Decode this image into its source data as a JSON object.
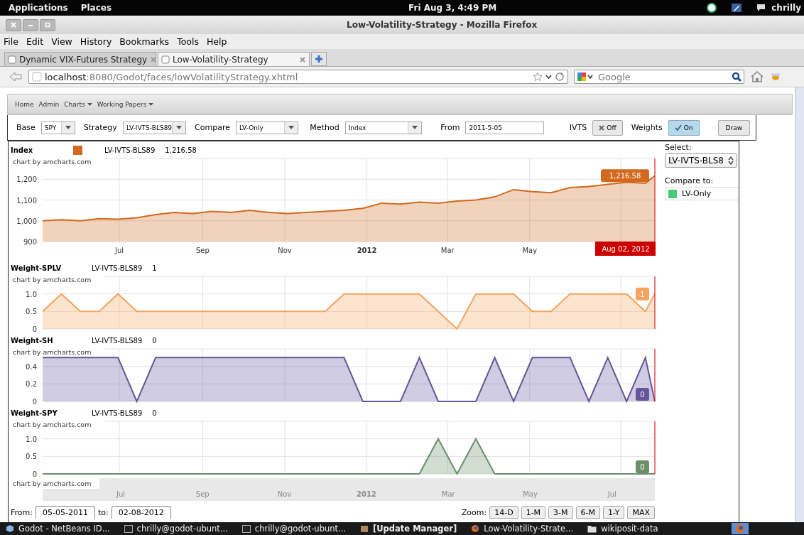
{
  "top_panel": {
    "menus": [
      "Applications",
      "Places"
    ],
    "clock": "Fri Aug  3,  4:49 PM",
    "user": "chrilly"
  },
  "window": {
    "title": "Low-Volatility-Strategy - Mozilla Firefox"
  },
  "menu_bar": [
    "File",
    "Edit",
    "View",
    "History",
    "Bookmarks",
    "Tools",
    "Help"
  ],
  "tabs": [
    {
      "label": "Dynamic VIX-Futures Strategy",
      "selected": false
    },
    {
      "label": "Low-Volatility-Strategy",
      "selected": true
    }
  ],
  "address_bar": {
    "host": "localhost",
    "path": ":8080/Godot/faces/lowVolatilityStrategy.xhtml"
  },
  "search": {
    "placeholder": "Google"
  },
  "site_nav": [
    {
      "label": "Home",
      "dropdown": false
    },
    {
      "label": "Admin",
      "dropdown": false
    },
    {
      "label": "Charts",
      "dropdown": true
    },
    {
      "label": "Working Papers",
      "dropdown": true
    }
  ],
  "form": [
    {
      "kind": "select",
      "label": "Base",
      "value": "SPY"
    },
    {
      "kind": "select",
      "label": "Strategy",
      "value": "LV-IVTS-BLS89"
    },
    {
      "kind": "select",
      "label": "Compare",
      "value": "LV-Only"
    },
    {
      "kind": "select",
      "label": "Method",
      "value": "Index"
    },
    {
      "kind": "text",
      "label": "From",
      "value": "2011-5-05"
    },
    {
      "kind": "toggle",
      "label": "IVTS",
      "value": "Off",
      "on": false
    },
    {
      "kind": "toggle",
      "label": "Weights",
      "value": "On",
      "on": true
    },
    {
      "kind": "button",
      "value": "Draw"
    }
  ],
  "charts": [
    {
      "legend_marker": true,
      "reading": "1,216.58",
      "credit": "chart by amcharts.com",
      "cursor_label": "Aug 02, 2012",
      "end_label": "1,216.58",
      "chart_data": {
        "type": "area",
        "title": "Index",
        "grid": true,
        "x": [
          "2011-05-05",
          "2011-05-19",
          "2011-06-02",
          "2011-06-16",
          "2011-06-30",
          "2011-07-14",
          "2011-07-28",
          "2011-08-11",
          "2011-08-25",
          "2011-09-08",
          "2011-09-22",
          "2011-10-06",
          "2011-10-20",
          "2011-11-03",
          "2011-11-17",
          "2011-12-01",
          "2011-12-15",
          "2011-12-29",
          "2012-01-12",
          "2012-01-26",
          "2012-02-09",
          "2012-02-23",
          "2012-03-08",
          "2012-03-22",
          "2012-04-05",
          "2012-04-19",
          "2012-05-03",
          "2012-05-17",
          "2012-05-31",
          "2012-06-14",
          "2012-06-28",
          "2012-07-12",
          "2012-07-26",
          "2012-08-02"
        ],
        "series": [
          {
            "name": "LV-IVTS-BLS89",
            "color": "#d2691e",
            "values": [
              1000,
              1005,
              1000,
              1010,
              1008,
              1015,
              1030,
              1040,
              1035,
              1045,
              1040,
              1050,
              1040,
              1035,
              1040,
              1045,
              1050,
              1060,
              1085,
              1080,
              1090,
              1085,
              1095,
              1100,
              1115,
              1150,
              1140,
              1135,
              1160,
              1165,
              1175,
              1185,
              1180,
              1217
            ]
          }
        ],
        "xlim": [
          "2011-05-05",
          "2012-08-02"
        ],
        "ylim": [
          900,
          1300
        ],
        "xticks": [
          {
            "value": "2011-07-01",
            "label": "Jul"
          },
          {
            "value": "2011-09-01",
            "label": "Sep"
          },
          {
            "value": "2011-11-01",
            "label": "Nov"
          },
          {
            "value": "2012-01-01",
            "label": "2012"
          },
          {
            "value": "2012-03-01",
            "label": "Mar"
          },
          {
            "value": "2012-05-01",
            "label": "May"
          }
        ],
        "yticks": [
          {
            "value": 900,
            "label": "900"
          },
          {
            "value": 1000,
            "label": "1,000"
          },
          {
            "value": 1100,
            "label": "1,100"
          },
          {
            "value": 1200,
            "label": "1,200"
          }
        ]
      }
    },
    {
      "legend_marker": false,
      "reading": "1",
      "credit": "chart by amcharts.com",
      "end_label": "1",
      "chart_data": {
        "type": "area",
        "title": "Weight-SPLV",
        "grid": true,
        "x": [
          "2011-05-05",
          "2011-05-19",
          "2011-06-02",
          "2011-06-16",
          "2011-06-30",
          "2011-07-14",
          "2011-07-28",
          "2011-08-11",
          "2011-08-25",
          "2011-09-08",
          "2011-09-22",
          "2011-10-06",
          "2011-10-20",
          "2011-11-03",
          "2011-11-17",
          "2011-12-01",
          "2011-12-15",
          "2011-12-29",
          "2012-01-12",
          "2012-01-26",
          "2012-02-09",
          "2012-02-23",
          "2012-03-08",
          "2012-03-22",
          "2012-04-05",
          "2012-04-19",
          "2012-05-03",
          "2012-05-17",
          "2012-05-31",
          "2012-06-14",
          "2012-06-28",
          "2012-07-12",
          "2012-07-26",
          "2012-08-02"
        ],
        "series": [
          {
            "name": "LV-IVTS-BLS89",
            "color": "#f4a460",
            "values": [
              0.5,
              1,
              0.5,
              0.5,
              1,
              0.5,
              0.5,
              0.5,
              0.5,
              0.5,
              0.5,
              0.5,
              0.5,
              0.5,
              0.5,
              0.5,
              1,
              1,
              1,
              1,
              1,
              0.5,
              0,
              1,
              1,
              1,
              0.5,
              0.5,
              1,
              1,
              1,
              1,
              0.5,
              1
            ]
          }
        ],
        "xlim": [
          "2011-05-05",
          "2012-08-02"
        ],
        "ylim": [
          0,
          1.5
        ],
        "yticks": [
          {
            "value": 0,
            "label": "0"
          },
          {
            "value": 0.5,
            "label": "0.5"
          },
          {
            "value": 1,
            "label": "1.0"
          }
        ]
      }
    },
    {
      "legend_marker": false,
      "reading": "0",
      "credit": "chart by amcharts.com",
      "end_label": "0",
      "chart_data": {
        "type": "area",
        "title": "Weight-SH",
        "grid": true,
        "x": [
          "2011-05-05",
          "2011-05-19",
          "2011-06-02",
          "2011-06-16",
          "2011-06-30",
          "2011-07-14",
          "2011-07-28",
          "2011-08-11",
          "2011-08-25",
          "2011-09-08",
          "2011-09-22",
          "2011-10-06",
          "2011-10-20",
          "2011-11-03",
          "2011-11-17",
          "2011-12-01",
          "2011-12-15",
          "2011-12-29",
          "2012-01-12",
          "2012-01-26",
          "2012-02-09",
          "2012-02-23",
          "2012-03-08",
          "2012-03-22",
          "2012-04-05",
          "2012-04-19",
          "2012-05-03",
          "2012-05-17",
          "2012-05-31",
          "2012-06-14",
          "2012-06-28",
          "2012-07-12",
          "2012-07-26",
          "2012-08-02"
        ],
        "series": [
          {
            "name": "LV-IVTS-BLS89",
            "color": "#65559a",
            "values": [
              0.5,
              0.5,
              0.5,
              0.5,
              0.5,
              0,
              0.5,
              0.5,
              0.5,
              0.5,
              0.5,
              0.5,
              0.5,
              0.5,
              0.5,
              0.5,
              0.5,
              0,
              0,
              0,
              0.5,
              0,
              0,
              0,
              0.5,
              0,
              0.5,
              0.5,
              0.5,
              0,
              0.5,
              0,
              0.5,
              0
            ]
          }
        ],
        "xlim": [
          "2011-05-05",
          "2012-08-02"
        ],
        "ylim": [
          0,
          0.6
        ],
        "yticks": [
          {
            "value": 0,
            "label": "0"
          },
          {
            "value": 0.2,
            "label": "0.2"
          },
          {
            "value": 0.4,
            "label": "0.4"
          }
        ]
      }
    },
    {
      "legend_marker": false,
      "reading": "0",
      "credit": "chart by amcharts.com",
      "end_label": "0",
      "chart_data": {
        "type": "area",
        "title": "Weight-SPY",
        "grid": true,
        "x": [
          "2011-05-05",
          "2011-05-19",
          "2011-06-02",
          "2011-06-16",
          "2011-06-30",
          "2011-07-14",
          "2011-07-28",
          "2011-08-11",
          "2011-08-25",
          "2011-09-08",
          "2011-09-22",
          "2011-10-06",
          "2011-10-20",
          "2011-11-03",
          "2011-11-17",
          "2011-12-01",
          "2011-12-15",
          "2011-12-29",
          "2012-01-12",
          "2012-01-26",
          "2012-02-09",
          "2012-02-23",
          "2012-03-08",
          "2012-03-22",
          "2012-04-05",
          "2012-04-19",
          "2012-05-03",
          "2012-05-17",
          "2012-05-31",
          "2012-06-14",
          "2012-06-28",
          "2012-07-12",
          "2012-07-26",
          "2012-08-02"
        ],
        "series": [
          {
            "name": "LV-IVTS-BLS89",
            "color": "#6b8e6b",
            "values": [
              0,
              0,
              0,
              0,
              0,
              0,
              0,
              0,
              0,
              0,
              0,
              0,
              0,
              0,
              0,
              0,
              0,
              0,
              0,
              0,
              0,
              1,
              0,
              1,
              0,
              0,
              0,
              0,
              0,
              0,
              0,
              0,
              0,
              0
            ]
          }
        ],
        "xlim": [
          "2011-05-05",
          "2012-08-02"
        ],
        "ylim": [
          0,
          1.5
        ],
        "yticks": [
          {
            "value": 0,
            "label": "0"
          },
          {
            "value": 0.5,
            "label": "0.5"
          },
          {
            "value": 1,
            "label": "1.0"
          }
        ]
      }
    }
  ],
  "navigator": {
    "credit": "chart by amcharts.com",
    "labels": [
      "Jul",
      "Sep",
      "Nov",
      "2012",
      "Mar",
      "May",
      "Jul"
    ]
  },
  "range": {
    "from_label": "From:",
    "from": "05-05-2011",
    "to_label": "to:",
    "to": "02-08-2012",
    "zoom_label": "Zoom:",
    "zoom_buttons": [
      "14-D",
      "1-M",
      "3-M",
      "6-M",
      "1-Y",
      "MAX"
    ]
  },
  "side_panel": {
    "select_label": "Select:",
    "select_value": "LV-IVTS-BLS8",
    "compare_label": "Compare to:",
    "compare_items": [
      {
        "label": "LV-Only",
        "color": "#44cc77"
      }
    ]
  },
  "taskbar": [
    {
      "kind": "cube",
      "label": "Godot - NetBeans ID...",
      "urgent": false
    },
    {
      "kind": "terminal",
      "label": "chrilly@godot-ubunt...",
      "urgent": false
    },
    {
      "kind": "terminal",
      "label": "chrilly@godot-ubunt...",
      "urgent": false
    },
    {
      "kind": "package",
      "label": "[Update Manager]",
      "urgent": true
    },
    {
      "kind": "browser",
      "label": "Low-Volatility-Strate...",
      "urgent": false
    },
    {
      "kind": "folder",
      "label": "wikiposit-data",
      "urgent": false
    }
  ]
}
